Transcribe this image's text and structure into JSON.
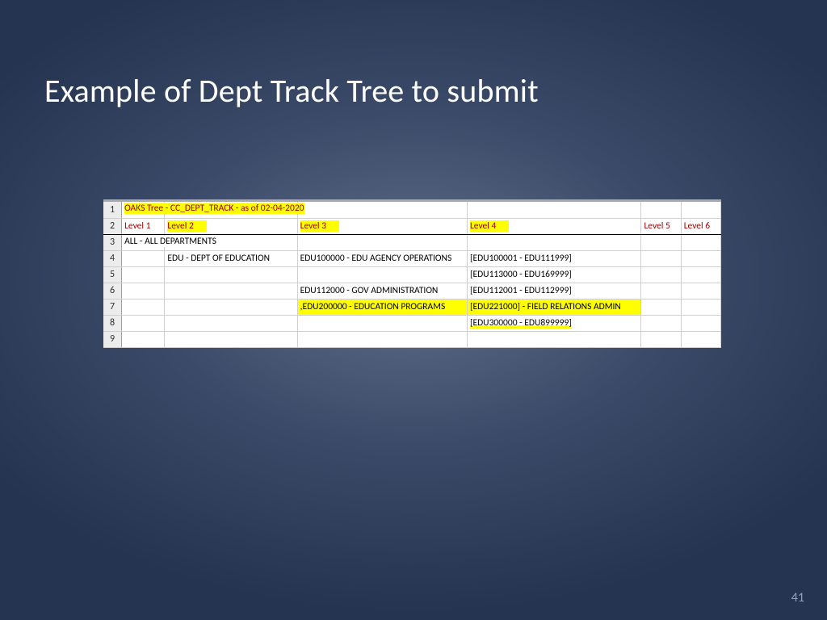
{
  "slide": {
    "title": "Example of Dept Track Tree to submit",
    "page_number": "41"
  },
  "sheet": {
    "row_labels": [
      "1",
      "2",
      "3",
      "4",
      "5",
      "6",
      "7",
      "8",
      "9"
    ],
    "r1c1": "OAKS Tree - CC_DEPT_TRACK - as of 02-04-2020",
    "h_level1": "Level 1",
    "h_level2": "Level 2",
    "h_level3": "Level 3",
    "h_level4": "Level 4",
    "h_level5": "Level 5",
    "h_level6": "Level 6",
    "r3c1": "ALL - ALL DEPARTMENTS",
    "r4c2": "EDU - DEPT OF EDUCATION",
    "r4c3": "EDU100000 - EDU AGENCY OPERATIONS",
    "r4c4": "[EDU100001 - EDU111999]",
    "r5c4": "[EDU113000 - EDU169999]",
    "r6c3": "EDU112000 - GOV ADMINISTRATION",
    "r6c4": "[EDU112001 - EDU112999]",
    "r7c3": ",EDU200000 - EDUCATION PROGRAMS",
    "r7c4": "[EDU221000] - FIELD RELATIONS ADMIN",
    "r8c4": "[EDU300000 - EDU899999]"
  }
}
